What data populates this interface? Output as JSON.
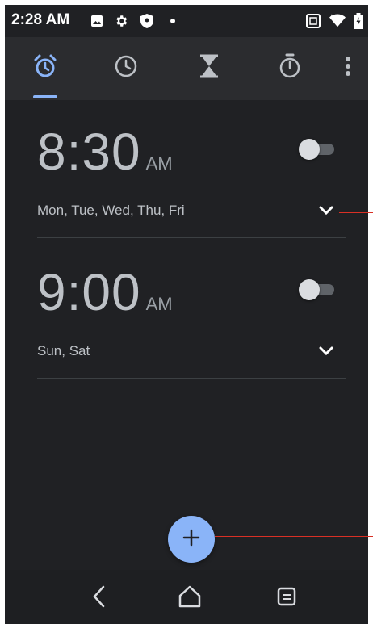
{
  "status_bar": {
    "time": "2:28 AM",
    "icons": [
      "image-icon",
      "gear-icon",
      "shield-icon",
      "dot-icon",
      "nfc-icon",
      "wifi-icon",
      "battery-icon"
    ]
  },
  "tabs": [
    {
      "name": "alarm",
      "icon": "alarm-icon",
      "selected": true
    },
    {
      "name": "clock",
      "icon": "clock-icon",
      "selected": false
    },
    {
      "name": "timer",
      "icon": "hourglass-icon",
      "selected": false
    },
    {
      "name": "stopwatch",
      "icon": "stopwatch-icon",
      "selected": false
    }
  ],
  "alarms": [
    {
      "time": "8:30",
      "ampm": "AM",
      "days": "Mon, Tue, Wed, Thu, Fri",
      "enabled": false
    },
    {
      "time": "9:00",
      "ampm": "AM",
      "days": "Sun, Sat",
      "enabled": false
    }
  ],
  "fab": {
    "label": "+"
  },
  "colors": {
    "background": "#202124",
    "accent": "#8ab4f8",
    "text": "#bdc1c6",
    "annotation": "#d93025"
  }
}
